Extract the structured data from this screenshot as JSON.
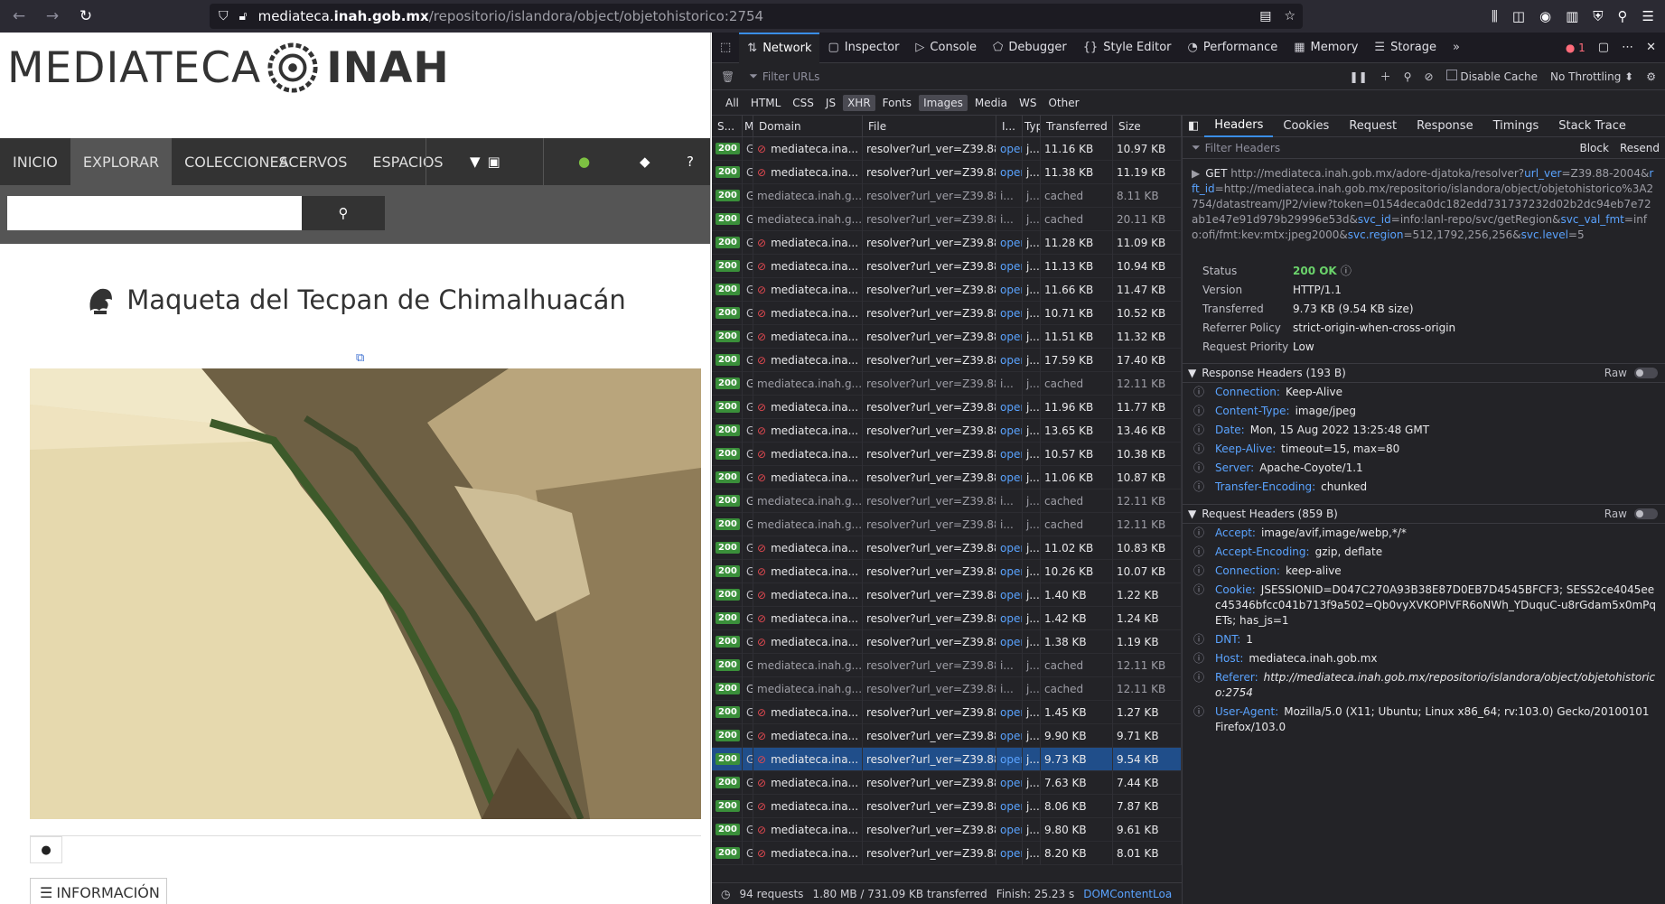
{
  "browser": {
    "url_prefix": "mediateca.",
    "url_host": "inah.gob.mx",
    "url_path": "/repositorio/islandora/object/objetohistorico:2754"
  },
  "site": {
    "logo_left": "MEDIATECA",
    "logo_right": "INAH",
    "nav": [
      "INICIO",
      "EXPLORAR",
      "COLECCIONES",
      "ACERVOS",
      "ESPACIOS"
    ],
    "search_placeholder": "",
    "title": "Maqueta del Tecpan de Chimalhuacán",
    "info_label": "INFORMACIÓN"
  },
  "devtools": {
    "tabs": [
      "Network",
      "Inspector",
      "Console",
      "Debugger",
      "Style Editor",
      "Performance",
      "Memory",
      "Storage"
    ],
    "error_count": "1",
    "filter_placeholder": "Filter URLs",
    "disable_cache": "Disable Cache",
    "throttling": "No Throttling ⬍",
    "type_filters": [
      "All",
      "HTML",
      "CSS",
      "JS",
      "XHR",
      "Fonts",
      "Images",
      "Media",
      "WS",
      "Other"
    ],
    "columns": [
      "S...",
      "M",
      "Domain",
      "File",
      "I...",
      "Typ",
      "Transferred",
      "Size"
    ],
    "rows": [
      {
        "status": "200",
        "m": "G",
        "domain": "mediateca.ina...",
        "file": "resolver?url_ver=Z39.88-2",
        "init": "open",
        "type": "j...",
        "trans": "11.16 KB",
        "size": "10.97 KB",
        "cached": false
      },
      {
        "status": "200",
        "m": "G",
        "domain": "mediateca.ina...",
        "file": "resolver?url_ver=Z39.88-2",
        "init": "open",
        "type": "j...",
        "trans": "11.38 KB",
        "size": "11.19 KB",
        "cached": false
      },
      {
        "status": "200",
        "m": "G",
        "domain": "mediateca.inah.g...",
        "file": "resolver?url_ver=Z39.88-2",
        "init": "i...",
        "type": "j...",
        "trans": "cached",
        "size": "8.11 KB",
        "cached": true
      },
      {
        "status": "200",
        "m": "G",
        "domain": "mediateca.inah.g...",
        "file": "resolver?url_ver=Z39.88-2",
        "init": "i...",
        "type": "j...",
        "trans": "cached",
        "size": "20.11 KB",
        "cached": true
      },
      {
        "status": "200",
        "m": "G",
        "domain": "mediateca.ina...",
        "file": "resolver?url_ver=Z39.88-2",
        "init": "open",
        "type": "j...",
        "trans": "11.28 KB",
        "size": "11.09 KB",
        "cached": false
      },
      {
        "status": "200",
        "m": "G",
        "domain": "mediateca.ina...",
        "file": "resolver?url_ver=Z39.88-2",
        "init": "open",
        "type": "j...",
        "trans": "11.13 KB",
        "size": "10.94 KB",
        "cached": false
      },
      {
        "status": "200",
        "m": "G",
        "domain": "mediateca.ina...",
        "file": "resolver?url_ver=Z39.88-2",
        "init": "open",
        "type": "j...",
        "trans": "11.66 KB",
        "size": "11.47 KB",
        "cached": false
      },
      {
        "status": "200",
        "m": "G",
        "domain": "mediateca.ina...",
        "file": "resolver?url_ver=Z39.88-2",
        "init": "open",
        "type": "j...",
        "trans": "10.71 KB",
        "size": "10.52 KB",
        "cached": false
      },
      {
        "status": "200",
        "m": "G",
        "domain": "mediateca.ina...",
        "file": "resolver?url_ver=Z39.88-2",
        "init": "open",
        "type": "j...",
        "trans": "11.51 KB",
        "size": "11.32 KB",
        "cached": false
      },
      {
        "status": "200",
        "m": "G",
        "domain": "mediateca.ina...",
        "file": "resolver?url_ver=Z39.88-2",
        "init": "open",
        "type": "j...",
        "trans": "17.59 KB",
        "size": "17.40 KB",
        "cached": false
      },
      {
        "status": "200",
        "m": "G",
        "domain": "mediateca.inah.g...",
        "file": "resolver?url_ver=Z39.88-2",
        "init": "i...",
        "type": "j...",
        "trans": "cached",
        "size": "12.11 KB",
        "cached": true
      },
      {
        "status": "200",
        "m": "G",
        "domain": "mediateca.ina...",
        "file": "resolver?url_ver=Z39.88-2",
        "init": "open",
        "type": "j...",
        "trans": "11.96 KB",
        "size": "11.77 KB",
        "cached": false
      },
      {
        "status": "200",
        "m": "G",
        "domain": "mediateca.ina...",
        "file": "resolver?url_ver=Z39.88-2",
        "init": "open",
        "type": "j...",
        "trans": "13.65 KB",
        "size": "13.46 KB",
        "cached": false
      },
      {
        "status": "200",
        "m": "G",
        "domain": "mediateca.ina...",
        "file": "resolver?url_ver=Z39.88-2",
        "init": "open",
        "type": "j...",
        "trans": "10.57 KB",
        "size": "10.38 KB",
        "cached": false
      },
      {
        "status": "200",
        "m": "G",
        "domain": "mediateca.ina...",
        "file": "resolver?url_ver=Z39.88-2",
        "init": "open",
        "type": "j...",
        "trans": "11.06 KB",
        "size": "10.87 KB",
        "cached": false
      },
      {
        "status": "200",
        "m": "G",
        "domain": "mediateca.inah.g...",
        "file": "resolver?url_ver=Z39.88-2",
        "init": "i...",
        "type": "j...",
        "trans": "cached",
        "size": "12.11 KB",
        "cached": true
      },
      {
        "status": "200",
        "m": "G",
        "domain": "mediateca.inah.g...",
        "file": "resolver?url_ver=Z39.88-2",
        "init": "i...",
        "type": "j...",
        "trans": "cached",
        "size": "12.11 KB",
        "cached": true
      },
      {
        "status": "200",
        "m": "G",
        "domain": "mediateca.ina...",
        "file": "resolver?url_ver=Z39.88-2",
        "init": "open",
        "type": "j...",
        "trans": "11.02 KB",
        "size": "10.83 KB",
        "cached": false
      },
      {
        "status": "200",
        "m": "G",
        "domain": "mediateca.ina...",
        "file": "resolver?url_ver=Z39.88-2",
        "init": "open",
        "type": "j...",
        "trans": "10.26 KB",
        "size": "10.07 KB",
        "cached": false
      },
      {
        "status": "200",
        "m": "G",
        "domain": "mediateca.ina...",
        "file": "resolver?url_ver=Z39.88-2",
        "init": "open",
        "type": "j...",
        "trans": "1.40 KB",
        "size": "1.22 KB",
        "cached": false
      },
      {
        "status": "200",
        "m": "G",
        "domain": "mediateca.ina...",
        "file": "resolver?url_ver=Z39.88-2",
        "init": "open",
        "type": "j...",
        "trans": "1.42 KB",
        "size": "1.24 KB",
        "cached": false
      },
      {
        "status": "200",
        "m": "G",
        "domain": "mediateca.ina...",
        "file": "resolver?url_ver=Z39.88-2",
        "init": "open",
        "type": "j...",
        "trans": "1.38 KB",
        "size": "1.19 KB",
        "cached": false
      },
      {
        "status": "200",
        "m": "G",
        "domain": "mediateca.inah.g...",
        "file": "resolver?url_ver=Z39.88-2",
        "init": "i...",
        "type": "j...",
        "trans": "cached",
        "size": "12.11 KB",
        "cached": true
      },
      {
        "status": "200",
        "m": "G",
        "domain": "mediateca.inah.g...",
        "file": "resolver?url_ver=Z39.88-2",
        "init": "i...",
        "type": "j...",
        "trans": "cached",
        "size": "12.11 KB",
        "cached": true
      },
      {
        "status": "200",
        "m": "G",
        "domain": "mediateca.ina...",
        "file": "resolver?url_ver=Z39.88-2",
        "init": "open",
        "type": "j...",
        "trans": "1.45 KB",
        "size": "1.27 KB",
        "cached": false
      },
      {
        "status": "200",
        "m": "G",
        "domain": "mediateca.ina...",
        "file": "resolver?url_ver=Z39.88-2",
        "init": "open",
        "type": "j...",
        "trans": "9.90 KB",
        "size": "9.71 KB",
        "cached": false
      },
      {
        "status": "200",
        "m": "G",
        "domain": "mediateca.ina...",
        "file": "resolver?url_ver=Z39.88-2",
        "init": "open",
        "type": "j...",
        "trans": "9.73 KB",
        "size": "9.54 KB",
        "cached": false,
        "selected": true
      },
      {
        "status": "200",
        "m": "G",
        "domain": "mediateca.ina...",
        "file": "resolver?url_ver=Z39.88-2",
        "init": "open",
        "type": "j...",
        "trans": "7.63 KB",
        "size": "7.44 KB",
        "cached": false
      },
      {
        "status": "200",
        "m": "G",
        "domain": "mediateca.ina...",
        "file": "resolver?url_ver=Z39.88-2",
        "init": "open",
        "type": "j...",
        "trans": "8.06 KB",
        "size": "7.87 KB",
        "cached": false
      },
      {
        "status": "200",
        "m": "G",
        "domain": "mediateca.ina...",
        "file": "resolver?url_ver=Z39.88-2",
        "init": "open",
        "type": "j...",
        "trans": "9.80 KB",
        "size": "9.61 KB",
        "cached": false
      },
      {
        "status": "200",
        "m": "G",
        "domain": "mediateca.ina...",
        "file": "resolver?url_ver=Z39.88-2",
        "init": "open",
        "type": "j...",
        "trans": "8.20 KB",
        "size": "8.01 KB",
        "cached": false
      }
    ],
    "status_bar": {
      "requests": "94 requests",
      "transferred": "1.80 MB / 731.09 KB transferred",
      "finish": "Finish: 25.23 s",
      "dcl": "DOMContentLoa"
    },
    "side_tabs": [
      "Headers",
      "Cookies",
      "Request",
      "Response",
      "Timings",
      "Stack Trace"
    ],
    "filter_headers": "Filter Headers",
    "block": "Block",
    "resend": "Resend",
    "request_url_parts": [
      {
        "t": "GET ",
        "c": "method"
      },
      {
        "t": "http://mediateca.inah.gob.mx/adore-djatoka/resolver?",
        "c": ""
      },
      {
        "t": "url_ver",
        "c": "p"
      },
      {
        "t": "=Z39.88-2004&",
        "c": ""
      },
      {
        "t": "rft_id",
        "c": "p"
      },
      {
        "t": "=http://mediateca.inah.gob.mx/repositorio/islandora/object/objetohistorico%3A2754/datastream/JP2/view?token=0154deca0dc182edd731737232d02b2dc94eb7e72ab1e47e91d979b29996e53d&",
        "c": ""
      },
      {
        "t": "svc_id",
        "c": "p"
      },
      {
        "t": "=info:lanl-repo/svc/getRegion&",
        "c": ""
      },
      {
        "t": "svc_val_fmt",
        "c": "p"
      },
      {
        "t": "=info:ofi/fmt:kev:mtx:jpeg2000&",
        "c": ""
      },
      {
        "t": "svc.region",
        "c": "p"
      },
      {
        "t": "=512,1792,256,256&",
        "c": ""
      },
      {
        "t": "svc.level",
        "c": "p"
      },
      {
        "t": "=5",
        "c": ""
      }
    ],
    "summary": {
      "status_label": "Status",
      "status_value": "200 OK",
      "version_label": "Version",
      "version_value": "HTTP/1.1",
      "transferred_label": "Transferred",
      "transferred_value": "9.73 KB (9.54 KB size)",
      "referrer_label": "Referrer Policy",
      "referrer_value": "strict-origin-when-cross-origin",
      "priority_label": "Request Priority",
      "priority_value": "Low"
    },
    "response_headers_title": "Response Headers (193 B)",
    "request_headers_title": "Request Headers (859 B)",
    "raw_label": "Raw",
    "response_headers": [
      {
        "k": "Connection:",
        "v": "Keep-Alive"
      },
      {
        "k": "Content-Type:",
        "v": "image/jpeg"
      },
      {
        "k": "Date:",
        "v": "Mon, 15 Aug 2022 13:25:48 GMT"
      },
      {
        "k": "Keep-Alive:",
        "v": "timeout=15, max=80"
      },
      {
        "k": "Server:",
        "v": "Apache-Coyote/1.1"
      },
      {
        "k": "Transfer-Encoding:",
        "v": "chunked"
      }
    ],
    "request_headers": [
      {
        "k": "Accept:",
        "v": "image/avif,image/webp,*/*"
      },
      {
        "k": "Accept-Encoding:",
        "v": "gzip, deflate"
      },
      {
        "k": "Connection:",
        "v": "keep-alive"
      },
      {
        "k": "Cookie:",
        "v": "JSESSIONID=D047C270A93B38E87D0EB7D4545BFCF3; SESS2ce4045eec45346bfcc041b713f9a502=Qb0vyXVKOPlVFR6oNWh_YDuquC-u8rGdam5x0mPqETs; has_js=1"
      },
      {
        "k": "DNT:",
        "v": "1"
      },
      {
        "k": "Host:",
        "v": "mediateca.inah.gob.mx"
      },
      {
        "k": "Referer:",
        "v": "http://mediateca.inah.gob.mx/repositorio/islandora/object/objetohistorico:2754",
        "italic": true
      },
      {
        "k": "User-Agent:",
        "v": "Mozilla/5.0 (X11; Ubuntu; Linux x86_64; rv:103.0) Gecko/20100101 Firefox/103.0"
      }
    ]
  }
}
